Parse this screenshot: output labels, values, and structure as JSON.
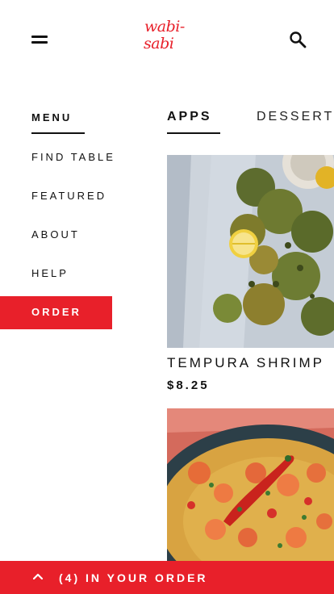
{
  "header": {
    "logo_line1": "wabi-",
    "logo_line2": "sabi",
    "menu_icon": "hamburger-menu-icon",
    "search_icon": "search-icon"
  },
  "sidebar": {
    "heading": "MENU",
    "items": [
      {
        "label": "FIND TABLE"
      },
      {
        "label": "FEATURED"
      },
      {
        "label": "ABOUT"
      },
      {
        "label": "HELP"
      }
    ],
    "order_label": "ORDER"
  },
  "tabs": [
    {
      "label": "APPS",
      "active": true
    },
    {
      "label": "DESSERTS",
      "active": false
    }
  ],
  "items": [
    {
      "name": "TEMPURA SHRIMP",
      "price": "$8.25",
      "image": "tempura-dish-photo"
    },
    {
      "name": "",
      "price": "",
      "image": "paella-shrimp-photo"
    }
  ],
  "order_bar": {
    "label": "(4) IN YOUR ORDER",
    "icon": "chevron-up-icon"
  },
  "colors": {
    "accent": "#e8202a",
    "text": "#111111",
    "background": "#ffffff"
  }
}
